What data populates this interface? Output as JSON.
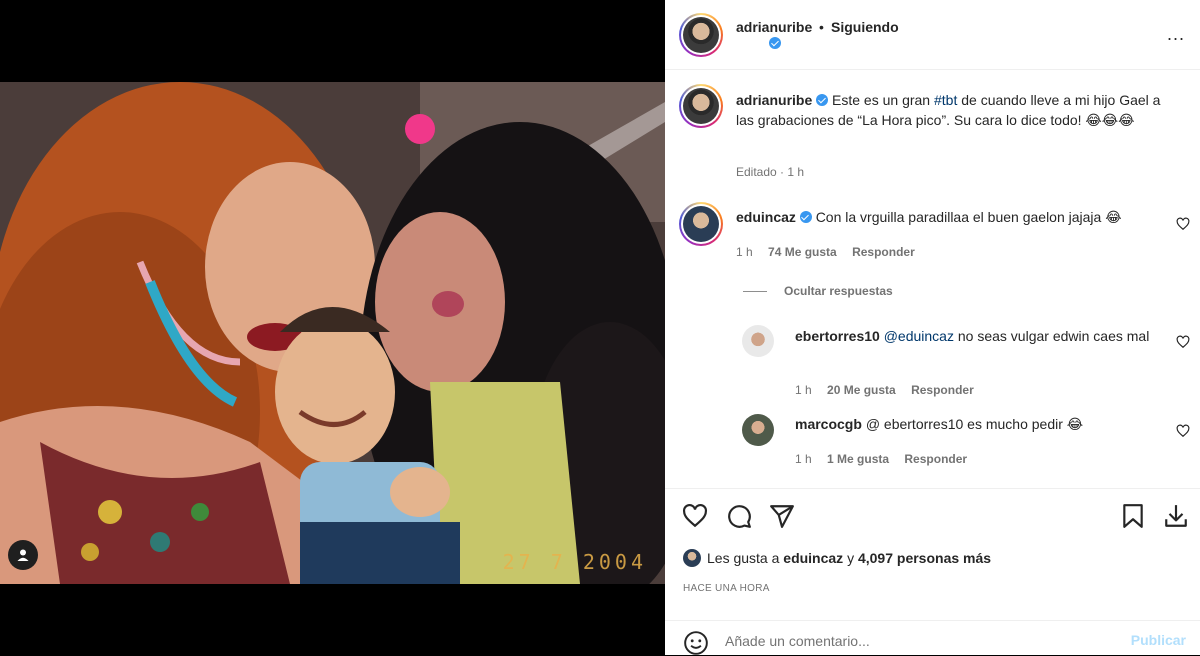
{
  "post": {
    "photo_date_stamp": "27 7 2004",
    "tag_icon": "user-tag-icon"
  },
  "header": {
    "username": "adrianuribe",
    "separator": "•",
    "follow_status": "Siguiendo",
    "more_icon": "ellipsis-icon",
    "more_label": "..."
  },
  "caption": {
    "username": "adrianuribe",
    "text_before": "Este es un gran ",
    "hashtag": "#tbt",
    "text_after": " de cuando lleve a mi hijo Gael a las grabaciones de “La Hora pico”. Su cara lo dice todo! 😂😂😂",
    "meta": "Editado · 1 h"
  },
  "comments": [
    {
      "username": "eduincaz",
      "verified": true,
      "text": "Con la vrguilla paradillaa el buen gaelon jajaja 😂",
      "time": "1 h",
      "likes": "74 Me gusta",
      "reply": "Responder"
    }
  ],
  "replies_toggle": "Ocultar respuestas",
  "replies": [
    {
      "username": "ebertorres10",
      "mention": "@eduincaz",
      "text": " no seas vulgar edwin caes mal",
      "time": "1 h",
      "likes": "20 Me gusta",
      "reply": "Responder"
    },
    {
      "username": "marcocgb",
      "text": "@ ebertorres10 es mucho pedir 😂",
      "time": "1 h",
      "likes": "1 Me gusta",
      "reply": "Responder"
    }
  ],
  "actions": {
    "like_icon": "heart-icon",
    "comment_icon": "comment-icon",
    "share_icon": "send-icon",
    "save_icon": "bookmark-icon",
    "download_icon": "download-icon"
  },
  "likes": {
    "prefix": "Les gusta a ",
    "first_user": "eduincaz",
    "middle": " y ",
    "count": "4,097 personas más"
  },
  "time_ago": "HACE UNA HORA",
  "composer": {
    "placeholder": "Añade un comentario...",
    "publish": "Publicar",
    "emoji_icon": "emoji-icon"
  },
  "colors": {
    "link": "#00376b",
    "verified": "#3897f0",
    "publish_disabled": "#b2dffc"
  }
}
